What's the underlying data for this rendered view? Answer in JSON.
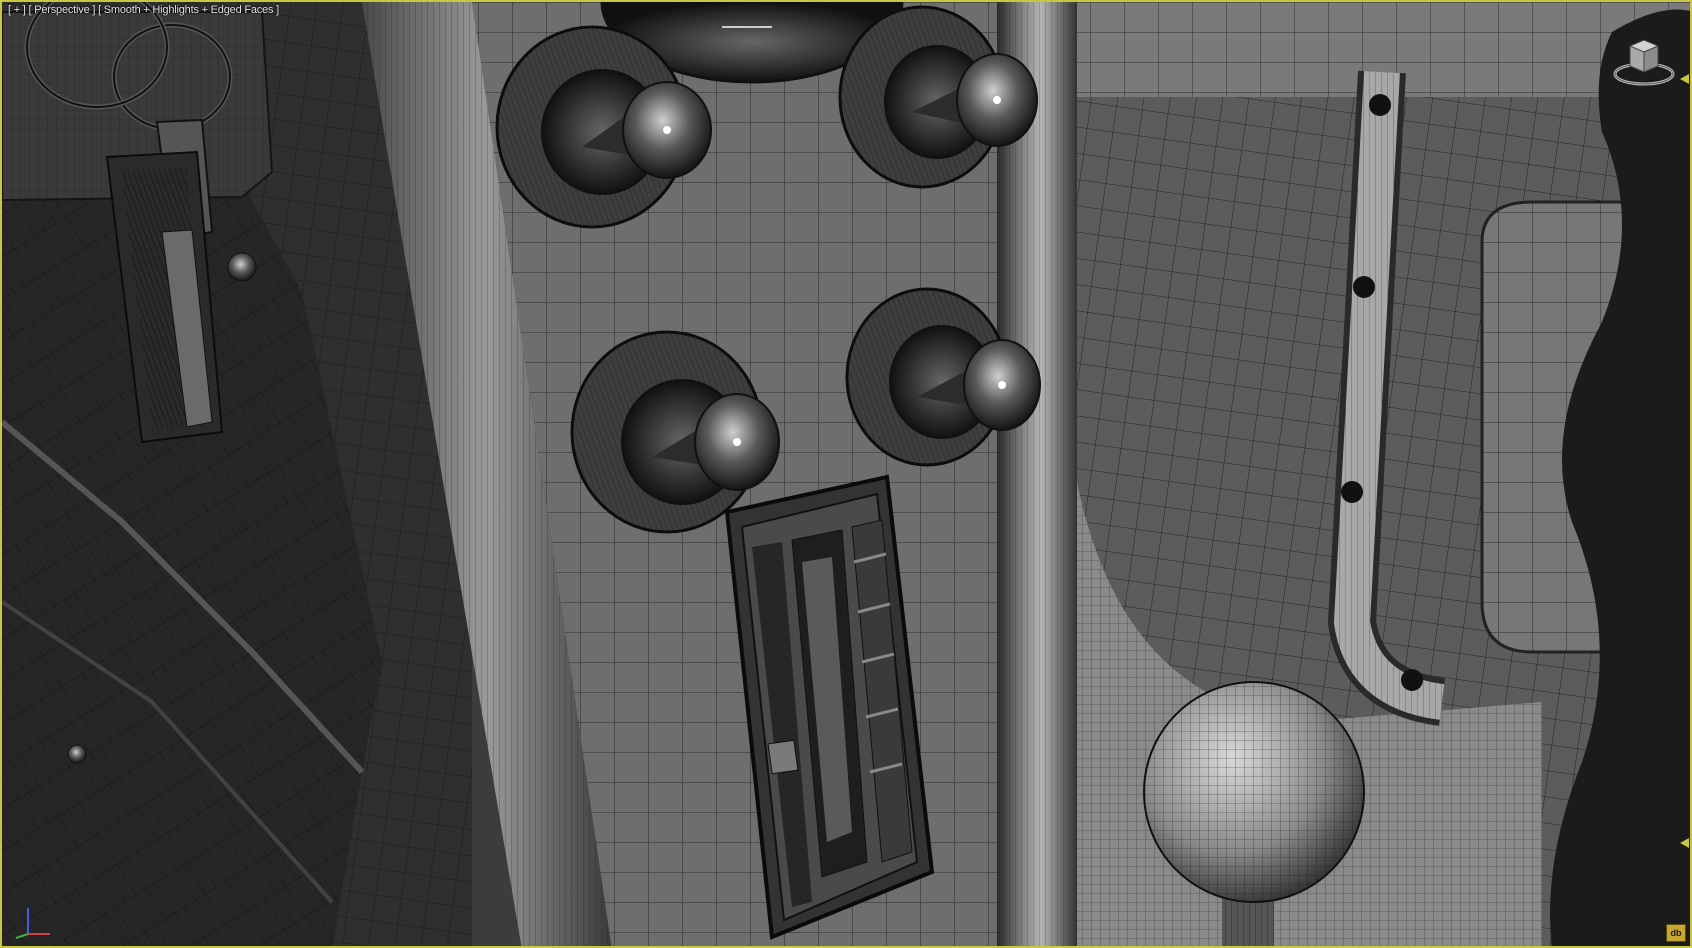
{
  "viewport": {
    "menu_label": "[ + ]",
    "view_label": "[ Perspective ]",
    "shading_label": "[ Smooth + Highlights + Edged Faces ]",
    "border_color": "#c9c545",
    "viewcube_icon": "viewcube-icon",
    "axis_icon": "axis-tripod-icon",
    "axis_colors": {
      "x": "#d04040",
      "y": "#40b040",
      "z": "#4060e0"
    },
    "status_badge": "db"
  }
}
